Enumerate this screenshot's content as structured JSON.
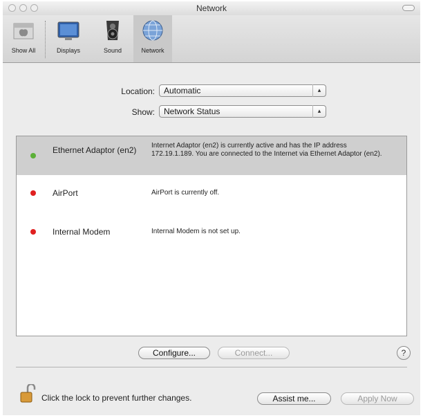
{
  "window": {
    "title": "Network"
  },
  "toolbar": {
    "items": [
      {
        "label": "Show All",
        "icon": "apple-icon"
      },
      {
        "label": "Displays",
        "icon": "display-icon"
      },
      {
        "label": "Sound",
        "icon": "speaker-icon"
      },
      {
        "label": "Network",
        "icon": "globe-icon"
      }
    ]
  },
  "location": {
    "label": "Location:",
    "value": "Automatic"
  },
  "show": {
    "label": "Show:",
    "value": "Network Status"
  },
  "ports": [
    {
      "name": "Ethernet Adaptor (en2)",
      "status": "Internet Adaptor (en2) is currently active and has the IP address 172.19.1.189. You are connected to the Internet via Ethernet Adaptor (en2).",
      "color": "#5cb038"
    },
    {
      "name": "AirPort",
      "status": "AirPort is currently off.",
      "color": "#e02020"
    },
    {
      "name": "Internal Modem",
      "status": "Internal Modem is not set up.",
      "color": "#e02020"
    }
  ],
  "buttons": {
    "configure": "Configure...",
    "connect": "Connect...",
    "help": "?",
    "assist": "Assist me...",
    "apply": "Apply Now"
  },
  "lock": {
    "text": "Click the lock to prevent further changes."
  }
}
